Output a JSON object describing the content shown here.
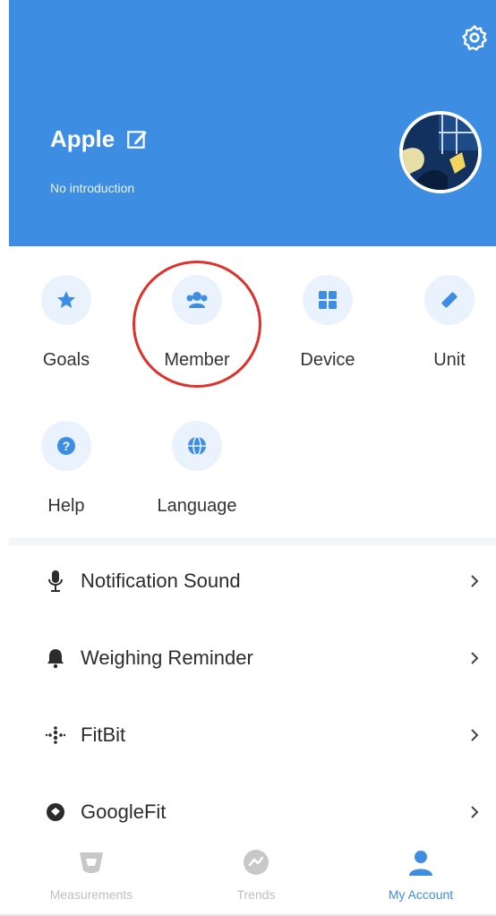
{
  "profile": {
    "name": "Apple",
    "introduction": "No introduction"
  },
  "grid": {
    "goals": "Goals",
    "member": "Member",
    "device": "Device",
    "unit": "Unit",
    "help": "Help",
    "language": "Language"
  },
  "settings": {
    "notification_sound": "Notification Sound",
    "weighing_reminder": "Weighing Reminder",
    "fitbit": "FitBit",
    "googlefit": "GoogleFit"
  },
  "tabs": {
    "measurements": "Measurements",
    "trends": "Trends",
    "my_account": "My Account"
  },
  "colors": {
    "primary": "#3d8ee3",
    "highlight": "#e0302b",
    "icon_circle": "#eaf3fd",
    "inactive_tab": "#bfbfbf"
  }
}
